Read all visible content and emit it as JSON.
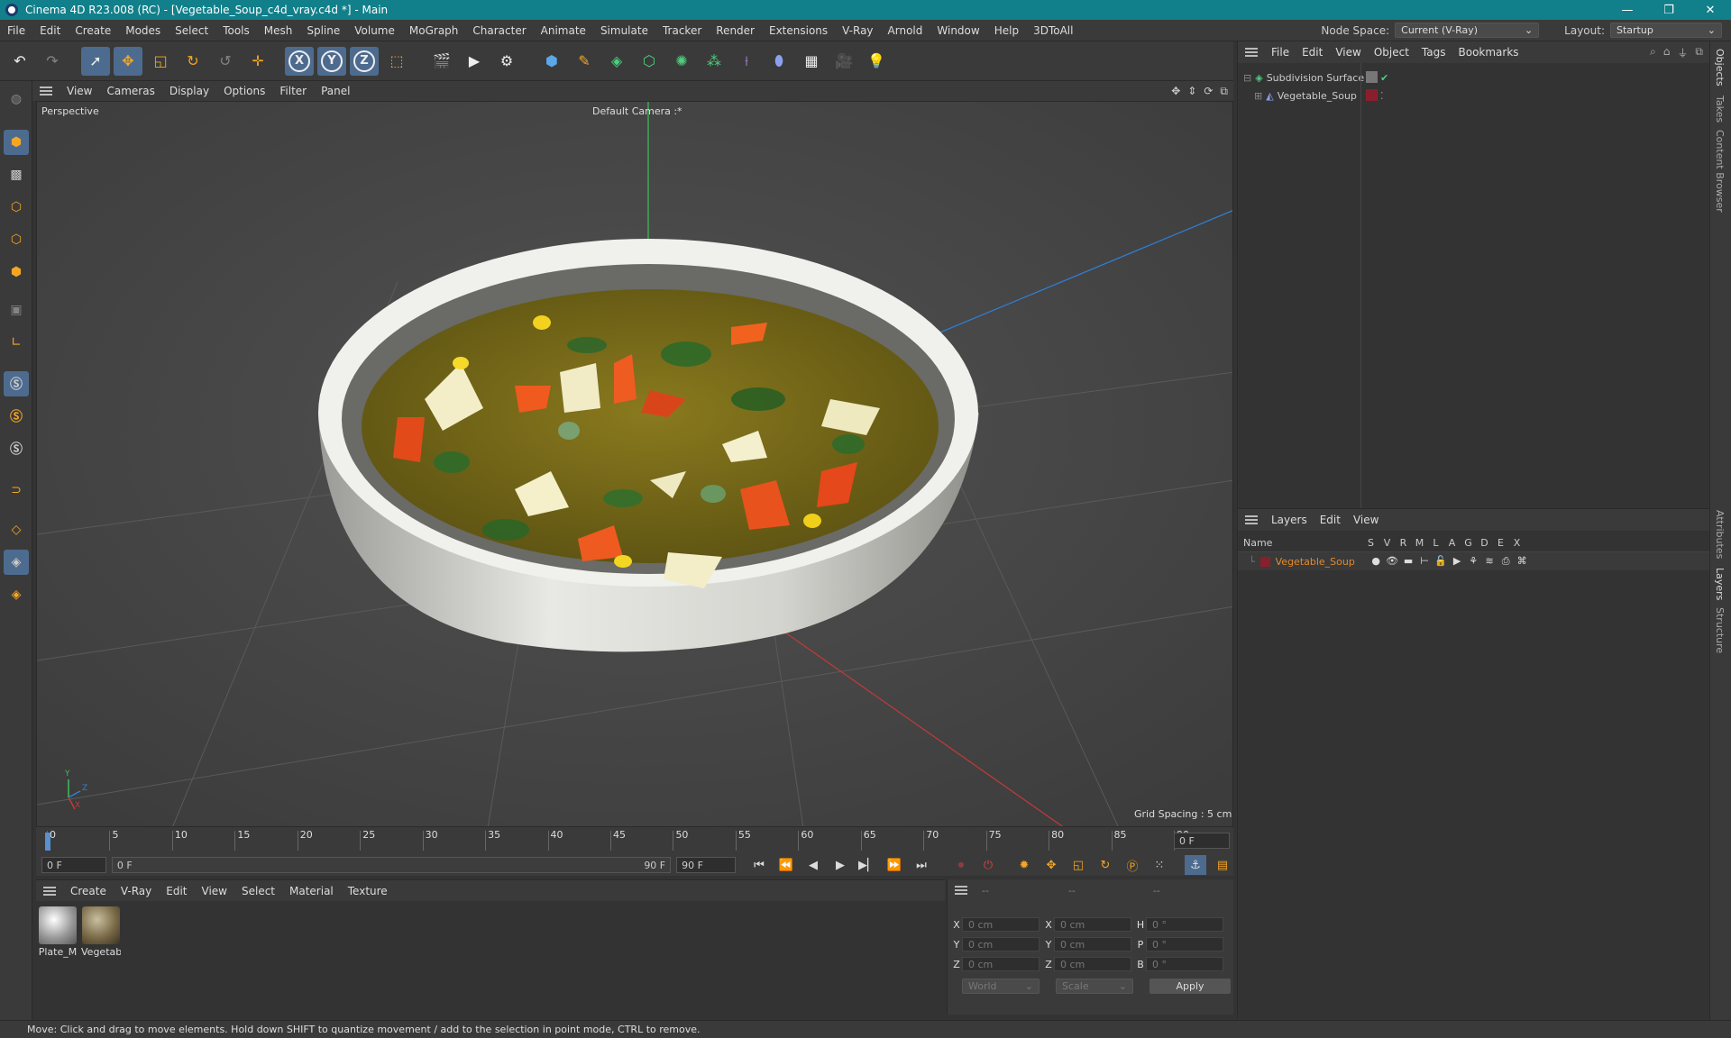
{
  "window": {
    "title": "Cinema 4D R23.008 (RC) - [Vegetable_Soup_c4d_vray.c4d *] - Main",
    "minimize": "—",
    "restore": "❐",
    "close": "✕"
  },
  "menu": [
    "File",
    "Edit",
    "Create",
    "Modes",
    "Select",
    "Tools",
    "Mesh",
    "Spline",
    "Volume",
    "MoGraph",
    "Character",
    "Animate",
    "Simulate",
    "Tracker",
    "Render",
    "Extensions",
    "V-Ray",
    "Arnold",
    "Window",
    "Help",
    "3DToAll"
  ],
  "nodespace": {
    "label": "Node Space:",
    "value": "Current (V-Ray)"
  },
  "layout": {
    "label": "Layout:",
    "value": "Startup"
  },
  "viewport_menu": [
    "View",
    "Cameras",
    "Display",
    "Options",
    "Filter",
    "Panel"
  ],
  "viewport": {
    "name": "Perspective",
    "camera": "Default Camera :*",
    "grid_spacing": "Grid Spacing : 5 cm",
    "axis_y": "Y",
    "axis_z": "Z",
    "axis_x": "X"
  },
  "timeline": {
    "ticks": [
      "0",
      "5",
      "10",
      "15",
      "20",
      "25",
      "30",
      "35",
      "40",
      "45",
      "50",
      "55",
      "60",
      "65",
      "70",
      "75",
      "80",
      "85",
      "90"
    ],
    "current": "0 F"
  },
  "controls": {
    "start": "0 F",
    "range_start": "0 F",
    "range_end": "90 F",
    "end": "90 F"
  },
  "material_menu": [
    "Create",
    "V-Ray",
    "Edit",
    "View",
    "Select",
    "Material",
    "Texture"
  ],
  "materials": [
    {
      "name": "Plate_M",
      "color": "#b8b8b8"
    },
    {
      "name": "Vegetab",
      "color": "#8a7a58"
    }
  ],
  "coords": {
    "headers": [
      "--",
      "--",
      "--"
    ],
    "rows": [
      {
        "a": "X",
        "av": "0 cm",
        "b": "X",
        "bv": "0 cm",
        "c": "H",
        "cv": "0 °"
      },
      {
        "a": "Y",
        "av": "0 cm",
        "b": "Y",
        "bv": "0 cm",
        "c": "P",
        "cv": "0 °"
      },
      {
        "a": "Z",
        "av": "0 cm",
        "b": "Z",
        "bv": "0 cm",
        "c": "B",
        "cv": "0 °"
      }
    ],
    "world": "World",
    "scale": "Scale",
    "apply": "Apply"
  },
  "object_menu": [
    "File",
    "Edit",
    "View",
    "Object",
    "Tags",
    "Bookmarks"
  ],
  "objects": [
    {
      "name": "Subdivision Surface"
    },
    {
      "name": "Vegetable_Soup"
    }
  ],
  "layer_menu": [
    "Layers",
    "Edit",
    "View"
  ],
  "layer_header": {
    "name": "Name",
    "cols": [
      "S",
      "V",
      "R",
      "M",
      "L",
      "A",
      "G",
      "D",
      "E",
      "X"
    ]
  },
  "layers": [
    {
      "name": "Vegetable_Soup",
      "color": "#8a1f2c"
    }
  ],
  "side_tabs": [
    "Objects",
    "Takes",
    "Content Browser",
    "Attributes",
    "Layers",
    "Structure"
  ],
  "status": "Move: Click and drag to move elements. Hold down SHIFT to quantize movement / add to the selection in point mode, CTRL to remove.",
  "colors": {
    "titlebar": "#11808a",
    "accent": "#4d6b8f",
    "layer_name": "#e08a2e"
  }
}
